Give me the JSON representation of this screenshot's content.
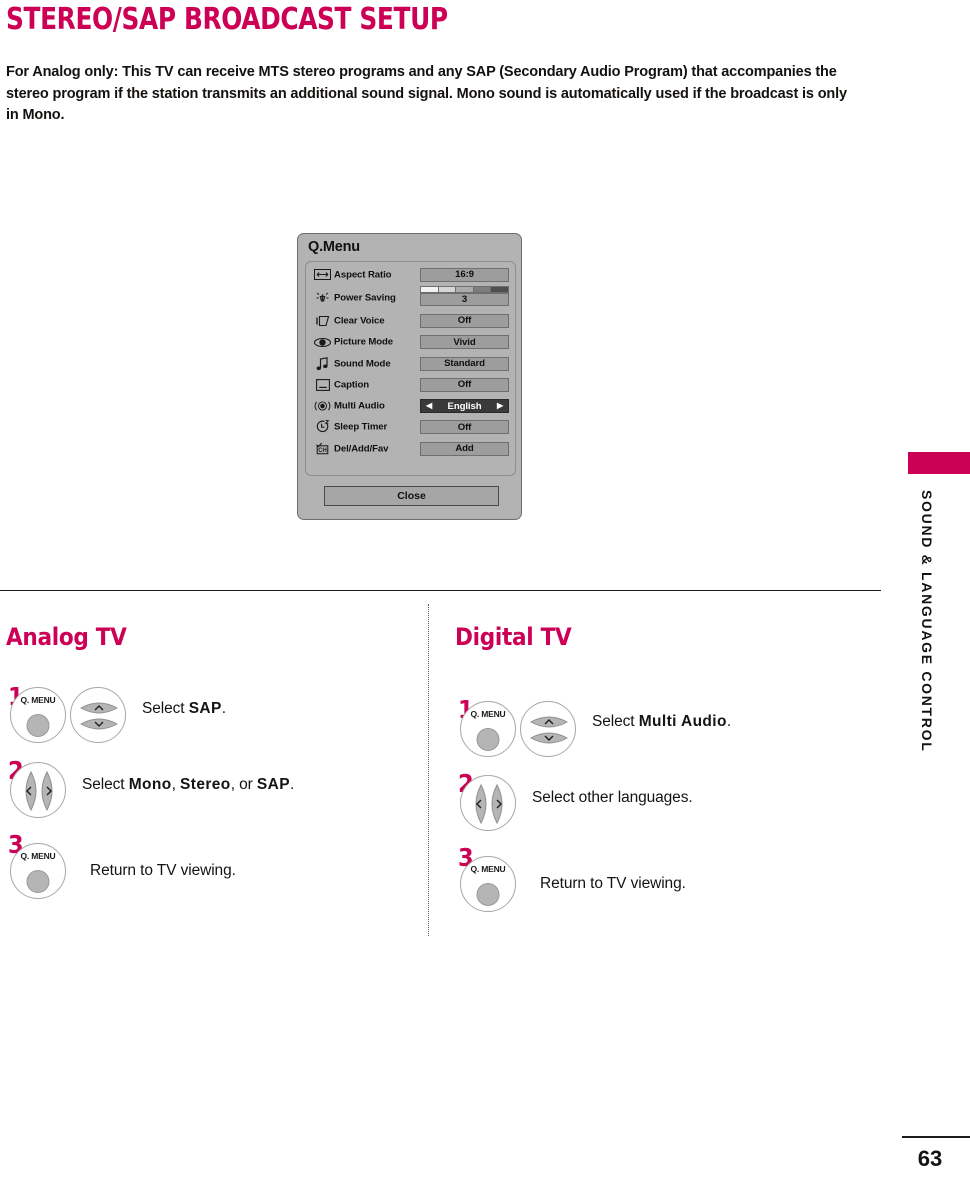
{
  "page": {
    "title": "STEREO/SAP BROADCAST SETUP",
    "intro": "For Analog only: This TV can receive MTS stereo programs and any SAP (Secondary Audio Program) that accompanies the stereo program if the station transmits an additional sound signal. Mono sound is automatically used if the broadcast is only in Mono.",
    "number": "63",
    "side_tab_label": "SOUND & LANGUAGE CONTROL",
    "accent_color": "#cc0055",
    "text_color": "#141414"
  },
  "qmenu": {
    "title": "Q.Menu",
    "close_label": "Close",
    "rows": [
      {
        "icon": "aspect-ratio-icon",
        "label": "Aspect Ratio",
        "value": "16:9",
        "selected": false,
        "bar": false
      },
      {
        "icon": "power-saving-icon",
        "label": "Power Saving",
        "value": "3",
        "selected": false,
        "bar": true
      },
      {
        "icon": "clear-voice-icon",
        "label": "Clear Voice",
        "value": "Off",
        "selected": false,
        "bar": false
      },
      {
        "icon": "picture-mode-icon",
        "label": "Picture Mode",
        "value": "Vivid",
        "selected": false,
        "bar": false
      },
      {
        "icon": "sound-mode-icon",
        "label": "Sound Mode",
        "value": "Standard",
        "selected": false,
        "bar": false
      },
      {
        "icon": "caption-icon",
        "label": "Caption",
        "value": "Off",
        "selected": false,
        "bar": false
      },
      {
        "icon": "multi-audio-icon",
        "label": "Multi Audio",
        "value": "English",
        "selected": true,
        "bar": false
      },
      {
        "icon": "sleep-timer-icon",
        "label": "Sleep Timer",
        "value": "Off",
        "selected": false,
        "bar": false
      },
      {
        "icon": "del-add-fav-icon",
        "label": "Del/Add/Fav",
        "value": "Add",
        "selected": false,
        "bar": false
      }
    ],
    "arrow_left": "◀",
    "arrow_right": "▶",
    "power_bar_segments": [
      "#f2f2f2",
      "#d6d6d6",
      "#ababab",
      "#7d7d7d",
      "#4f4f4f"
    ],
    "panel_color": "#b3b3b3",
    "value_color": "#9d9d9d",
    "selected_color": "#3a3a3a"
  },
  "analog": {
    "title": "Analog TV",
    "steps": [
      {
        "num": "1",
        "button": "Q. MENU",
        "text_prefix": "Select ",
        "text_bold": "SAP",
        "text_suffix": "."
      },
      {
        "num": "2",
        "button": "",
        "text_prefix": "Select ",
        "text_bold": "Mono",
        "text_mid": ", ",
        "text_bold2": "Stereo",
        "text_mid2": ", or ",
        "text_bold3": "SAP",
        "text_suffix": "."
      },
      {
        "num": "3",
        "button": "Q. MENU",
        "text_prefix": "Return to TV viewing.",
        "text_bold": "",
        "text_suffix": ""
      }
    ]
  },
  "digital": {
    "title": "Digital TV",
    "steps": [
      {
        "num": "1",
        "button": "Q. MENU",
        "text_prefix": "Select ",
        "text_bold": "Multi Audio",
        "text_suffix": "."
      },
      {
        "num": "2",
        "button": "",
        "text_prefix": "Select other languages.",
        "text_bold": "",
        "text_suffix": ""
      },
      {
        "num": "3",
        "button": "Q. MENU",
        "text_prefix": "Return to TV viewing.",
        "text_bold": "",
        "text_suffix": ""
      }
    ]
  }
}
